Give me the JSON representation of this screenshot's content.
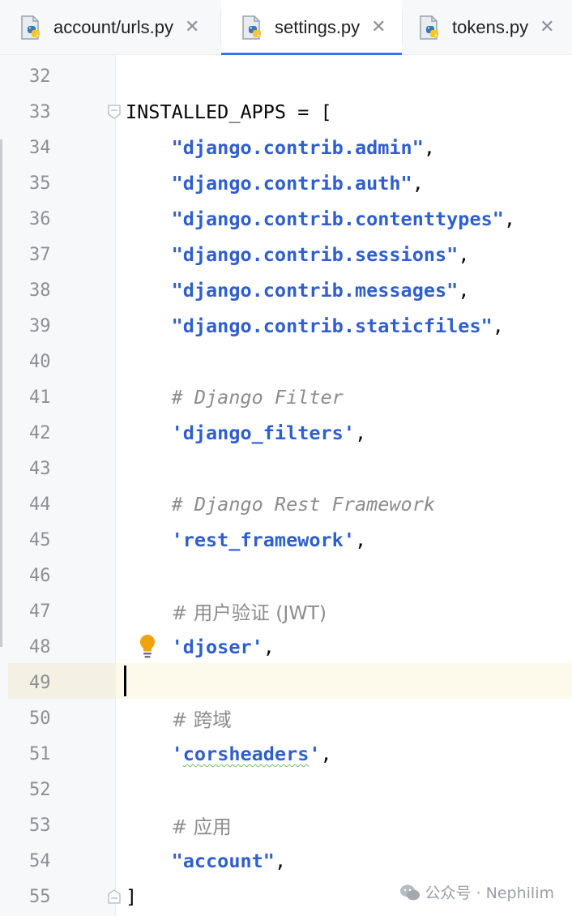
{
  "tabs": [
    {
      "label": "account/urls.py",
      "active": false,
      "icon": "python-file-icon",
      "close": "✕"
    },
    {
      "label": "settings.py",
      "active": true,
      "icon": "python-file-icon",
      "close": "✕"
    },
    {
      "label": "tokens.py",
      "active": false,
      "icon": "python-file-icon",
      "close": "✕"
    }
  ],
  "editor": {
    "accent": "#3574f0",
    "string_color": "#2f5fcf",
    "comment_color": "#8c8c8c",
    "current_line": 49,
    "lines": [
      {
        "n": "32",
        "parts": []
      },
      {
        "n": "33",
        "parts": [
          {
            "t": "INSTALLED_APPS = [",
            "c": "plain"
          }
        ],
        "fold": "open"
      },
      {
        "n": "34",
        "parts": [
          {
            "t": "    ",
            "c": "plain"
          },
          {
            "t": "\"django.contrib.admin\"",
            "c": "str"
          },
          {
            "t": ",",
            "c": "plain"
          }
        ]
      },
      {
        "n": "35",
        "parts": [
          {
            "t": "    ",
            "c": "plain"
          },
          {
            "t": "\"django.contrib.auth\"",
            "c": "str"
          },
          {
            "t": ",",
            "c": "plain"
          }
        ]
      },
      {
        "n": "36",
        "parts": [
          {
            "t": "    ",
            "c": "plain"
          },
          {
            "t": "\"django.contrib.contenttypes\"",
            "c": "str"
          },
          {
            "t": ",",
            "c": "plain"
          }
        ]
      },
      {
        "n": "37",
        "parts": [
          {
            "t": "    ",
            "c": "plain"
          },
          {
            "t": "\"django.contrib.sessions\"",
            "c": "str"
          },
          {
            "t": ",",
            "c": "plain"
          }
        ]
      },
      {
        "n": "38",
        "parts": [
          {
            "t": "    ",
            "c": "plain"
          },
          {
            "t": "\"django.contrib.messages\"",
            "c": "str"
          },
          {
            "t": ",",
            "c": "plain"
          }
        ]
      },
      {
        "n": "39",
        "parts": [
          {
            "t": "    ",
            "c": "plain"
          },
          {
            "t": "\"django.contrib.staticfiles\"",
            "c": "str"
          },
          {
            "t": ",",
            "c": "plain"
          }
        ]
      },
      {
        "n": "40",
        "parts": []
      },
      {
        "n": "41",
        "parts": [
          {
            "t": "    ",
            "c": "plain"
          },
          {
            "t": "# Django Filter",
            "c": "cmt"
          }
        ]
      },
      {
        "n": "42",
        "parts": [
          {
            "t": "    ",
            "c": "plain"
          },
          {
            "t": "'django_filters'",
            "c": "str"
          },
          {
            "t": ",",
            "c": "plain"
          }
        ]
      },
      {
        "n": "43",
        "parts": []
      },
      {
        "n": "44",
        "parts": [
          {
            "t": "    ",
            "c": "plain"
          },
          {
            "t": "# Django Rest Framework",
            "c": "cmt"
          }
        ]
      },
      {
        "n": "45",
        "parts": [
          {
            "t": "    ",
            "c": "plain"
          },
          {
            "t": "'rest_framework'",
            "c": "str"
          },
          {
            "t": ",",
            "c": "plain"
          }
        ]
      },
      {
        "n": "46",
        "parts": []
      },
      {
        "n": "47",
        "parts": [
          {
            "t": "    ",
            "c": "plain"
          },
          {
            "t": "# 用户验证 (JWT)",
            "c": "cmt"
          }
        ]
      },
      {
        "n": "48",
        "parts": [
          {
            "t": "    ",
            "c": "plain"
          },
          {
            "t": "'djoser'",
            "c": "str"
          },
          {
            "t": ",",
            "c": "plain"
          }
        ],
        "bulb": true
      },
      {
        "n": "49",
        "parts": []
      },
      {
        "n": "50",
        "parts": [
          {
            "t": "    ",
            "c": "plain"
          },
          {
            "t": "# 跨域",
            "c": "cmt"
          }
        ]
      },
      {
        "n": "51",
        "parts": [
          {
            "t": "    ",
            "c": "plain"
          },
          {
            "t": "'",
            "c": "str"
          },
          {
            "t": "corsheaders",
            "c": "str typo"
          },
          {
            "t": "'",
            "c": "str"
          },
          {
            "t": ",",
            "c": "plain"
          }
        ]
      },
      {
        "n": "52",
        "parts": []
      },
      {
        "n": "53",
        "parts": [
          {
            "t": "    ",
            "c": "plain"
          },
          {
            "t": "# 应用",
            "c": "cmt"
          }
        ]
      },
      {
        "n": "54",
        "parts": [
          {
            "t": "    ",
            "c": "plain"
          },
          {
            "t": "\"account\"",
            "c": "str"
          },
          {
            "t": ",",
            "c": "plain"
          }
        ]
      },
      {
        "n": "55",
        "parts": [
          {
            "t": "]",
            "c": "plain"
          }
        ],
        "fold": "close"
      }
    ]
  },
  "watermark": {
    "text": "公众号 · Nephilim",
    "icon": "wechat-icon"
  }
}
